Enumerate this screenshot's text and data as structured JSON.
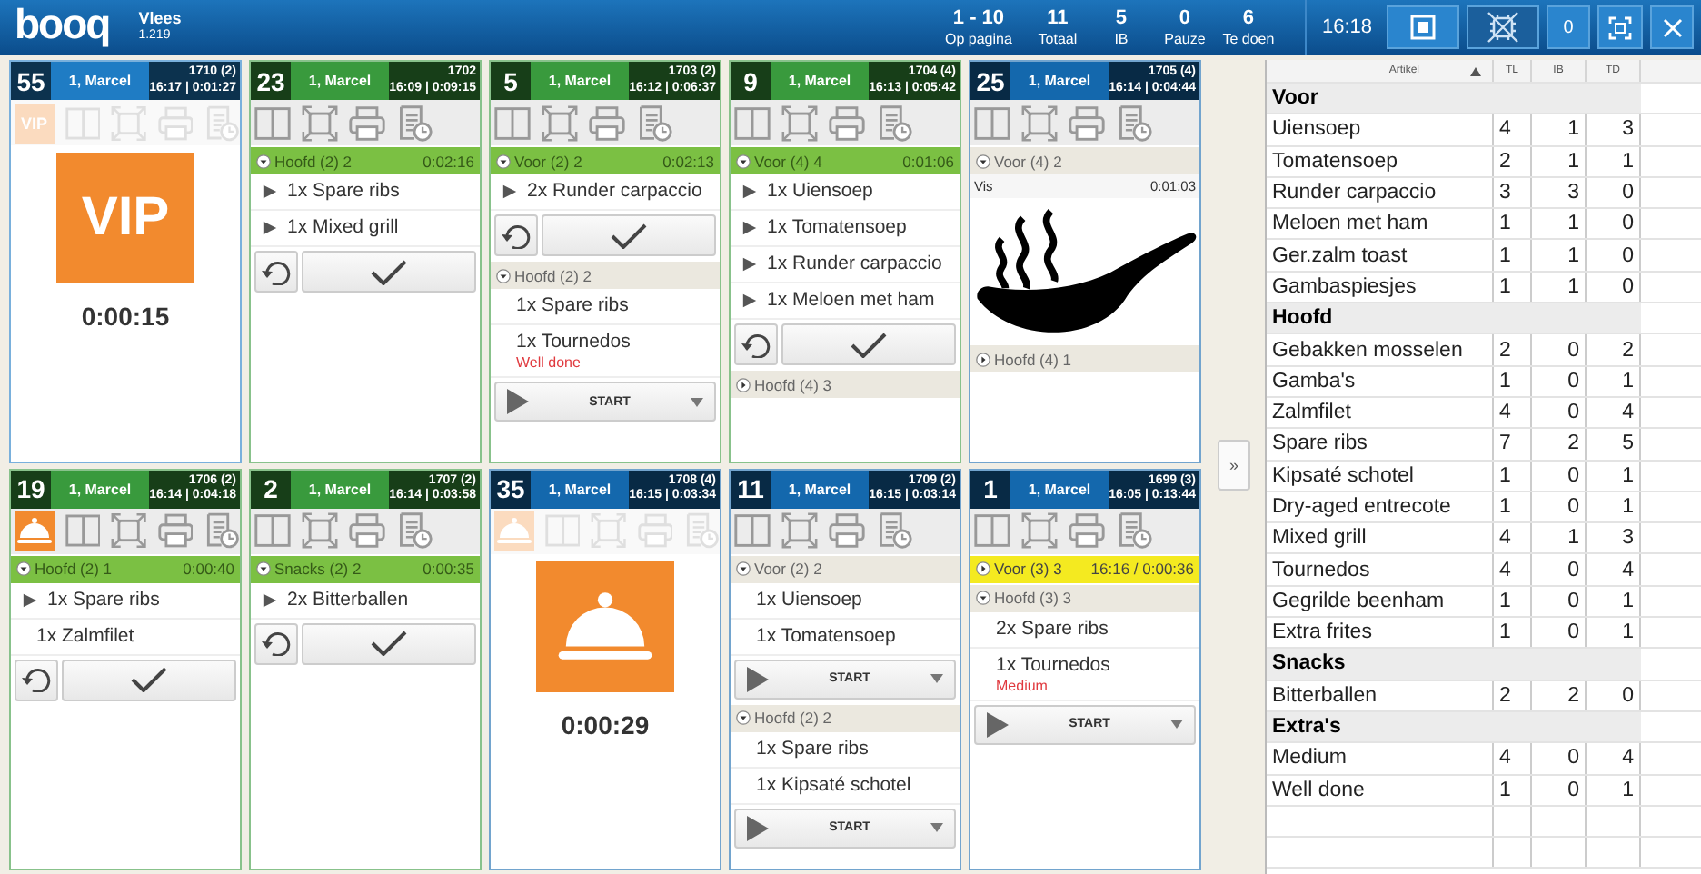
{
  "topbar": {
    "logo": "booq",
    "title": "Vlees",
    "version": "1.219",
    "stats": [
      {
        "value": "1 - 10",
        "label": "Op pagina"
      },
      {
        "value": "11",
        "label": "Totaal"
      },
      {
        "value": "5",
        "label": "IB"
      },
      {
        "value": "0",
        "label": "Pauze"
      },
      {
        "value": "6",
        "label": "Te doen"
      }
    ],
    "clock": "16:18",
    "buttons": [
      {
        "kind": "window"
      },
      {
        "kind": "blocked"
      },
      {
        "kind": "counter",
        "label": "0"
      },
      {
        "kind": "fullscreen"
      },
      {
        "kind": "close"
      }
    ]
  },
  "cards": [
    {
      "number": "55",
      "waiter": "1, Marcel",
      "order": "1710 (2)",
      "times": "16:17 | 0:01:27",
      "color": "#1f7cc4",
      "badge": {
        "kind": "vip",
        "label": "VIP"
      },
      "overlay": {
        "kind": "vip",
        "label": "VIP",
        "timer": "0:00:15"
      }
    },
    {
      "number": "23",
      "waiter": "1, Marcel",
      "order": "1702",
      "times": "16:09 | 0:09:15",
      "color": "#399a3d",
      "sections": [
        {
          "label": "Hoofd (2) 2",
          "time": "0:02:16",
          "kind": "active",
          "expanded": true,
          "items": [
            {
              "text": "1x Spare ribs",
              "kind": "cooking"
            },
            {
              "text": "1x Mixed grill",
              "kind": "cooking"
            }
          ],
          "footer": {
            "kind": "confirm"
          }
        }
      ]
    },
    {
      "number": "5",
      "waiter": "1, Marcel",
      "order": "1703 (2)",
      "times": "16:12 | 0:06:37",
      "color": "#399a3d",
      "sections": [
        {
          "label": "Voor (2) 2",
          "time": "0:02:13",
          "kind": "active",
          "expanded": true,
          "items": [
            {
              "text": "2x Runder carpaccio",
              "kind": "cooking"
            }
          ],
          "footer": {
            "kind": "confirm"
          }
        },
        {
          "label": "Hoofd (2) 2",
          "kind": "plain",
          "expanded": true,
          "items": [
            {
              "text": "1x Spare ribs",
              "kind": "plain"
            },
            {
              "text": "1x Tournedos",
              "kind": "plain",
              "note": "Well done"
            }
          ],
          "footer": {
            "kind": "start",
            "label": "START"
          }
        }
      ]
    },
    {
      "number": "9",
      "waiter": "1, Marcel",
      "order": "1704 (4)",
      "times": "16:13 | 0:05:42",
      "color": "#399a3d",
      "sections": [
        {
          "label": "Voor (4) 4",
          "time": "0:01:06",
          "kind": "active",
          "expanded": true,
          "items": [
            {
              "text": "1x Uiensoep",
              "kind": "cooking"
            },
            {
              "text": "1x Tomatensoep",
              "kind": "cooking"
            },
            {
              "text": "1x Runder carpaccio",
              "kind": "cooking"
            },
            {
              "text": "1x Meloen met ham",
              "kind": "cooking"
            }
          ],
          "footer": {
            "kind": "confirm"
          }
        },
        {
          "label": "Hoofd (4) 3",
          "kind": "plain",
          "expanded": false
        }
      ]
    },
    {
      "number": "25",
      "waiter": "1, Marcel",
      "order": "1705 (4)",
      "times": "16:14 | 0:04:44",
      "color": "#1468ad",
      "sections": [
        {
          "label": "Voor (4) 2",
          "kind": "plain",
          "expanded": true,
          "media": {
            "label": "Vis",
            "time": "0:01:03"
          }
        },
        {
          "label": "Hoofd (4) 1",
          "kind": "plain",
          "expanded": false
        }
      ]
    },
    {
      "number": "19",
      "waiter": "1, Marcel",
      "order": "1706 (2)",
      "times": "16:14 | 0:04:18",
      "color": "#399a3d",
      "badge": {
        "kind": "cloche"
      },
      "sections": [
        {
          "label": "Hoofd (2) 1",
          "time": "0:00:40",
          "kind": "active",
          "expanded": true,
          "items": [
            {
              "text": "1x Spare ribs",
              "kind": "cooking"
            },
            {
              "text": "1x Zalmfilet",
              "kind": "ready"
            }
          ],
          "footer": {
            "kind": "confirm"
          }
        }
      ]
    },
    {
      "number": "2",
      "waiter": "1, Marcel",
      "order": "1707 (2)",
      "times": "16:14 | 0:03:58",
      "color": "#399a3d",
      "sections": [
        {
          "label": "Snacks (2) 2",
          "time": "0:00:35",
          "kind": "active",
          "expanded": true,
          "items": [
            {
              "text": "2x Bitterballen",
              "kind": "cooking"
            }
          ],
          "footer": {
            "kind": "confirm"
          }
        }
      ]
    },
    {
      "number": "35",
      "waiter": "1, Marcel",
      "order": "1708 (4)",
      "times": "16:15 | 0:03:34",
      "color": "#1468ad",
      "badge": {
        "kind": "cloche"
      },
      "overlay": {
        "kind": "cloche",
        "timer": "0:00:29"
      }
    },
    {
      "number": "11",
      "waiter": "1, Marcel",
      "order": "1709 (2)",
      "times": "16:15 | 0:03:14",
      "color": "#1468ad",
      "sections": [
        {
          "label": "Voor (2) 2",
          "kind": "plain",
          "expanded": true,
          "items": [
            {
              "text": "1x Uiensoep",
              "kind": "plain"
            },
            {
              "text": "1x Tomatensoep",
              "kind": "plain"
            }
          ],
          "footer": {
            "kind": "start",
            "label": "START"
          }
        },
        {
          "label": "Hoofd (2) 2",
          "kind": "plain",
          "expanded": true,
          "items": [
            {
              "text": "1x Spare ribs",
              "kind": "plain"
            },
            {
              "text": "1x Kipsaté schotel",
              "kind": "plain"
            }
          ],
          "footer": {
            "kind": "start",
            "label": "START"
          }
        }
      ]
    },
    {
      "number": "1",
      "waiter": "1, Marcel",
      "order": "1699 (3)",
      "times": "16:05 | 0:13:44",
      "color": "#1468ad",
      "sections": [
        {
          "label": "Voor (3) 3",
          "time": "16:16 / 0:00:36",
          "kind": "scheduled",
          "expanded": false
        },
        {
          "label": "Hoofd (3) 3",
          "kind": "plain",
          "expanded": true,
          "items": [
            {
              "text": "2x Spare ribs",
              "kind": "plain"
            },
            {
              "text": "1x Tournedos",
              "kind": "plain",
              "note": "Medium"
            }
          ],
          "footer": {
            "kind": "start",
            "label": "START"
          }
        }
      ]
    }
  ],
  "expand_button": "»",
  "summary": {
    "columns": [
      "Artikel",
      "TL",
      "IB",
      "TD"
    ],
    "groups": [
      {
        "name": "Voor",
        "rows": [
          [
            "Uiensoep",
            "4",
            "1",
            "3"
          ],
          [
            "Tomatensoep",
            "2",
            "1",
            "1"
          ],
          [
            "Runder carpaccio",
            "3",
            "3",
            "0"
          ],
          [
            "Meloen met ham",
            "1",
            "1",
            "0"
          ],
          [
            "Ger.zalm toast",
            "1",
            "1",
            "0"
          ],
          [
            "Gambaspiesjes",
            "1",
            "1",
            "0"
          ]
        ]
      },
      {
        "name": "Hoofd",
        "rows": [
          [
            "Gebakken mosselen",
            "2",
            "0",
            "2"
          ],
          [
            "Gamba's",
            "1",
            "0",
            "1"
          ],
          [
            "Zalmfilet",
            "4",
            "0",
            "4"
          ],
          [
            "Spare ribs",
            "7",
            "2",
            "5"
          ],
          [
            "Kipsaté schotel",
            "1",
            "0",
            "1"
          ],
          [
            "Dry-aged entrecote",
            "1",
            "0",
            "1"
          ],
          [
            "Mixed grill",
            "4",
            "1",
            "3"
          ],
          [
            "Tournedos",
            "4",
            "0",
            "4"
          ],
          [
            "Gegrilde beenham",
            "1",
            "0",
            "1"
          ],
          [
            "Extra frites",
            "1",
            "0",
            "1"
          ]
        ]
      },
      {
        "name": "Snacks",
        "rows": [
          [
            "Bitterballen",
            "2",
            "2",
            "0"
          ]
        ]
      },
      {
        "name": "Extra's",
        "rows": [
          [
            "Medium",
            "4",
            "0",
            "4"
          ],
          [
            "Well done",
            "1",
            "0",
            "1"
          ]
        ]
      }
    ]
  }
}
